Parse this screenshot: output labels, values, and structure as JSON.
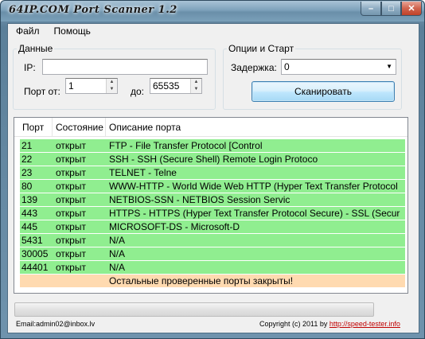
{
  "window": {
    "title": "64IP.COM Port Scanner 1.2",
    "min": "–",
    "max": "□",
    "close": "✕"
  },
  "menu": [
    "Файл",
    "Помощь"
  ],
  "data_group": {
    "legend": "Данные",
    "ip_label": "IP:",
    "ip_value": "",
    "port_from_label": "Порт от:",
    "port_from": "1",
    "port_to_label": "до:",
    "port_to": "65535"
  },
  "options_group": {
    "legend": "Опции и Старт",
    "delay_label": "Задержка:",
    "delay_value": "0",
    "scan_button": "Сканировать"
  },
  "list": {
    "columns": [
      "Порт",
      "Состояние",
      "Описание порта"
    ],
    "rows": [
      {
        "port": "21",
        "state": "открыт",
        "desc": "FTP - File Transfer Protocol [Control"
      },
      {
        "port": "22",
        "state": "открыт",
        "desc": "SSH - SSH (Secure Shell) Remote Login Protoco"
      },
      {
        "port": "23",
        "state": "открыт",
        "desc": "TELNET - Telne"
      },
      {
        "port": "80",
        "state": "открыт",
        "desc": "WWW-HTTP - World Wide Web HTTP (Hyper Text Transfer Protocol"
      },
      {
        "port": "139",
        "state": "открыт",
        "desc": "NETBIOS-SSN - NETBIOS Session Servic"
      },
      {
        "port": "443",
        "state": "открыт",
        "desc": "HTTPS - HTTPS (Hyper Text Transfer Protocol Secure) - SSL (Secur"
      },
      {
        "port": "445",
        "state": "открыт",
        "desc": "MICROSOFT-DS - Microsoft-D"
      },
      {
        "port": "5431",
        "state": "открыт",
        "desc": "N/A"
      },
      {
        "port": "30005",
        "state": "открыт",
        "desc": "N/A"
      },
      {
        "port": "44401",
        "state": "открыт",
        "desc": "N/A"
      }
    ],
    "closed_note": "Остальные проверенные порты закрыты!"
  },
  "progress": {
    "value": 0
  },
  "footer": {
    "email": "Email:admin02@inbox.lv",
    "copyright": "Copyright (c) 2011 by ",
    "link": "http://speed-tester.info"
  },
  "colors": {
    "open_row": "#90ee90",
    "note_row": "#ffdab0"
  }
}
